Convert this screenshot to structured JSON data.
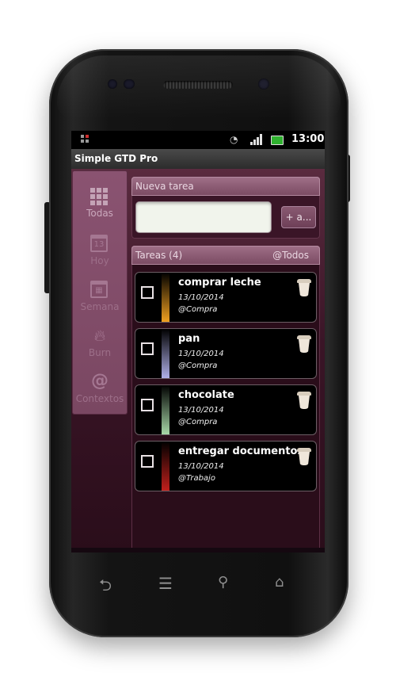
{
  "status_bar": {
    "time": "13:00",
    "icons": [
      "notification-icon",
      "wifi-icon",
      "signal-icon",
      "battery-icon"
    ]
  },
  "app": {
    "title": "Simple GTD Pro"
  },
  "sidebar": {
    "items": [
      {
        "label": "Todas",
        "icon": "grid-icon",
        "active": true
      },
      {
        "label": "Hoy",
        "icon": "calendar-day-icon",
        "icon_text": "13",
        "active": false
      },
      {
        "label": "Semana",
        "icon": "calendar-week-icon",
        "active": false
      },
      {
        "label": "Burn",
        "icon": "flame-icon",
        "active": false
      },
      {
        "label": "Contextos",
        "icon": "at-icon",
        "active": false
      }
    ]
  },
  "new_task": {
    "header": "Nueva tarea",
    "input_value": "",
    "add_button": "+ a..."
  },
  "tasks": {
    "header": "Tareas (4)",
    "filter": "@Todos",
    "items": [
      {
        "title": "comprar leche",
        "date": "13/10/2014",
        "context": "@Compra",
        "color": "#f0a020"
      },
      {
        "title": "pan",
        "date": "13/10/2014",
        "context": "@Compra",
        "color": "#b0b0e8"
      },
      {
        "title": "chocolate",
        "date": "13/10/2014",
        "context": "@Compra",
        "color": "#a8d8a8"
      },
      {
        "title": "entregar documentos",
        "date": "13/10/2014",
        "context": "@Trabajo",
        "color": "#c0201c"
      }
    ]
  },
  "nav_keys": [
    "back-icon",
    "menu-icon",
    "search-icon",
    "home-icon"
  ],
  "colors": {
    "accent": "#8a5371",
    "background": "#2a0d1a"
  }
}
